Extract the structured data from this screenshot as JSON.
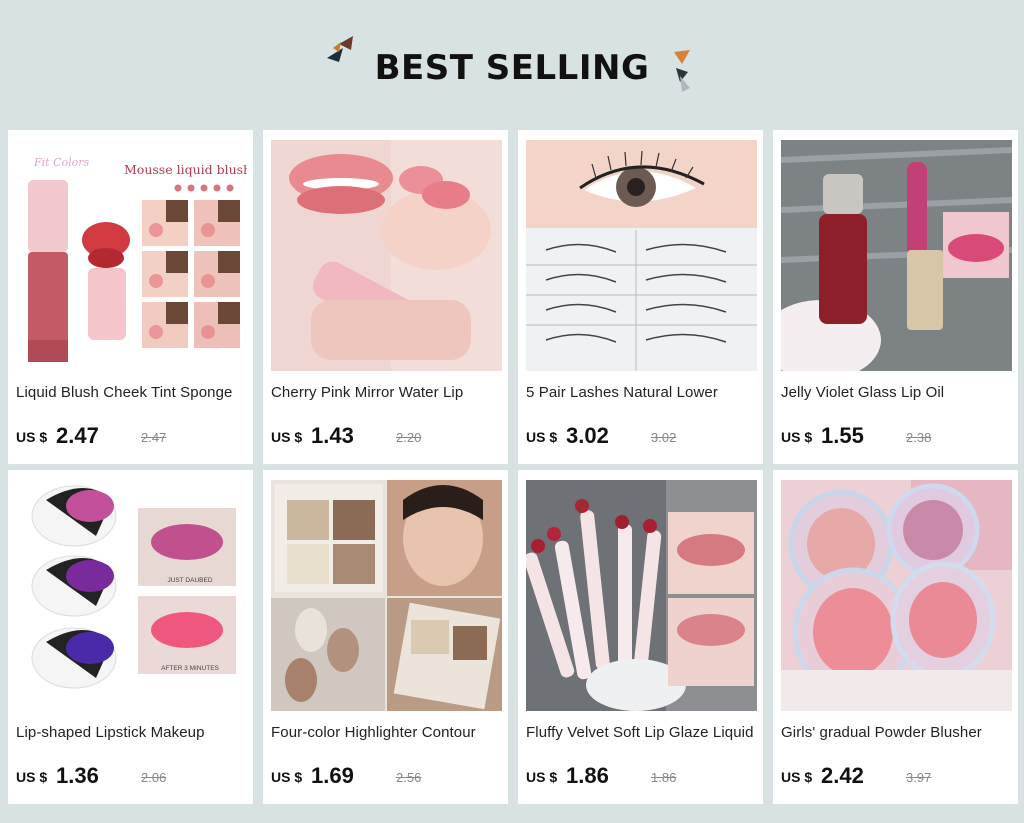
{
  "header": {
    "title": "BEST SELLING"
  },
  "products": [
    {
      "name": "Liquid Blush Cheek Tint Sponge",
      "currency": "US $",
      "price": "2.47",
      "original_price": "2.47",
      "image_text": [
        "Fit Colors",
        "Mousse liquid blush"
      ]
    },
    {
      "name": "Cherry Pink Mirror Water Lip",
      "currency": "US $",
      "price": "1.43",
      "original_price": "2.20"
    },
    {
      "name": "5 Pair Lashes Natural Lower",
      "currency": "US $",
      "price": "3.02",
      "original_price": "3.02"
    },
    {
      "name": "Jelly Violet Glass Lip Oil",
      "currency": "US $",
      "price": "1.55",
      "original_price": "2.38"
    },
    {
      "name": "Lip-shaped Lipstick Makeup",
      "currency": "US $",
      "price": "1.36",
      "original_price": "2.06",
      "image_text": [
        "JUST DAUBED",
        "AFTER 3 MINUTES"
      ]
    },
    {
      "name": "Four-color Highlighter Contour",
      "currency": "US $",
      "price": "1.69",
      "original_price": "2.56"
    },
    {
      "name": "Fluffy Velvet Soft Lip Glaze Liquid",
      "currency": "US $",
      "price": "1.86",
      "original_price": "1.86"
    },
    {
      "name": "Girls' gradual Powder Blusher",
      "currency": "US $",
      "price": "2.42",
      "original_price": "3.97"
    }
  ],
  "colors": {
    "background": "#d8e2e3",
    "card": "#ffffff",
    "text": "#111111",
    "strike": "#888888"
  }
}
